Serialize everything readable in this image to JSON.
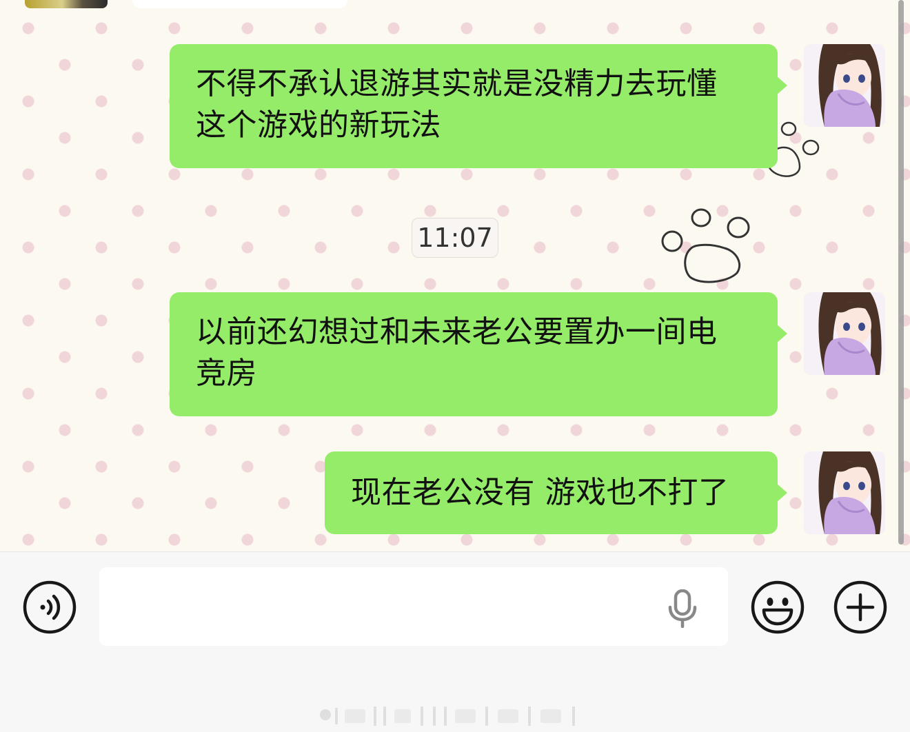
{
  "messages": [
    {
      "text": "不得不承认退游其实就是没精力去玩懂\n这个游戏的新玩法",
      "sender": "self"
    },
    {
      "text": "以前还幻想过和未来老公要置办一间电\n竞房",
      "sender": "self"
    },
    {
      "text": "现在老公没有 游戏也不打了",
      "sender": "self"
    }
  ],
  "timestamp": "11:07",
  "input": {
    "value": "",
    "placeholder": ""
  },
  "icons": {
    "voice": "voice-toggle-icon",
    "mic": "microphone-icon",
    "emoji": "emoji-icon",
    "plus": "plus-icon",
    "paw": "paw-print-decoration"
  },
  "colors": {
    "bubble_self": "#95ec69",
    "chat_background": "#fcf9f1",
    "dot_pattern": "#f1d6d9",
    "input_bar": "#f7f7f7"
  }
}
